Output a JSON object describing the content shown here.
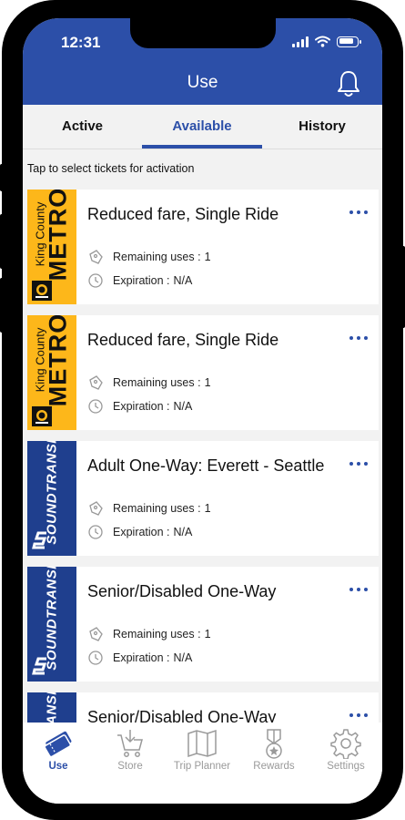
{
  "status_bar": {
    "time": "12:31"
  },
  "header": {
    "title": "Use"
  },
  "tabs": [
    {
      "label": "Active",
      "selected": false
    },
    {
      "label": "Available",
      "selected": true
    },
    {
      "label": "History",
      "selected": false
    }
  ],
  "hint": "Tap to select tickets for activation",
  "tickets": [
    {
      "agency": "King County METRO",
      "logo_line1": "King County",
      "logo_line2": "METRO",
      "title": "Reduced fare, Single Ride",
      "remaining_label": "Remaining uses :",
      "remaining_value": "1",
      "expiration_label": "Expiration :",
      "expiration_value": "N/A"
    },
    {
      "agency": "King County METRO",
      "logo_line1": "King County",
      "logo_line2": "METRO",
      "title": "Reduced fare, Single Ride",
      "remaining_label": "Remaining uses :",
      "remaining_value": "1",
      "expiration_label": "Expiration :",
      "expiration_value": "N/A"
    },
    {
      "agency": "Sound Transit",
      "logo_text": "SOUNDTRANSIT",
      "title": "Adult One-Way: Everett - Seattle",
      "remaining_label": "Remaining uses :",
      "remaining_value": "1",
      "expiration_label": "Expiration :",
      "expiration_value": "N/A"
    },
    {
      "agency": "Sound Transit",
      "logo_text": "SOUNDTRANSIT",
      "title": "Senior/Disabled One-Way",
      "remaining_label": "Remaining uses :",
      "remaining_value": "1",
      "expiration_label": "Expiration :",
      "expiration_value": "N/A"
    },
    {
      "agency": "Sound Transit",
      "logo_text": "SOUNDTRANSIT",
      "title": "Senior/Disabled One-Way"
    }
  ],
  "bottom_nav": [
    {
      "label": "Use",
      "icon": "ticket-icon",
      "active": true
    },
    {
      "label": "Store",
      "icon": "cart-icon",
      "active": false
    },
    {
      "label": "Trip Planner",
      "icon": "map-icon",
      "active": false
    },
    {
      "label": "Rewards",
      "icon": "medal-icon",
      "active": false
    },
    {
      "label": "Settings",
      "icon": "gear-icon",
      "active": false
    }
  ],
  "colors": {
    "brand_blue": "#2c4fa8",
    "metro_yellow": "#fdb71a",
    "sound_transit_blue": "#1f3f8e",
    "inactive_gray": "#9a9a9a"
  }
}
